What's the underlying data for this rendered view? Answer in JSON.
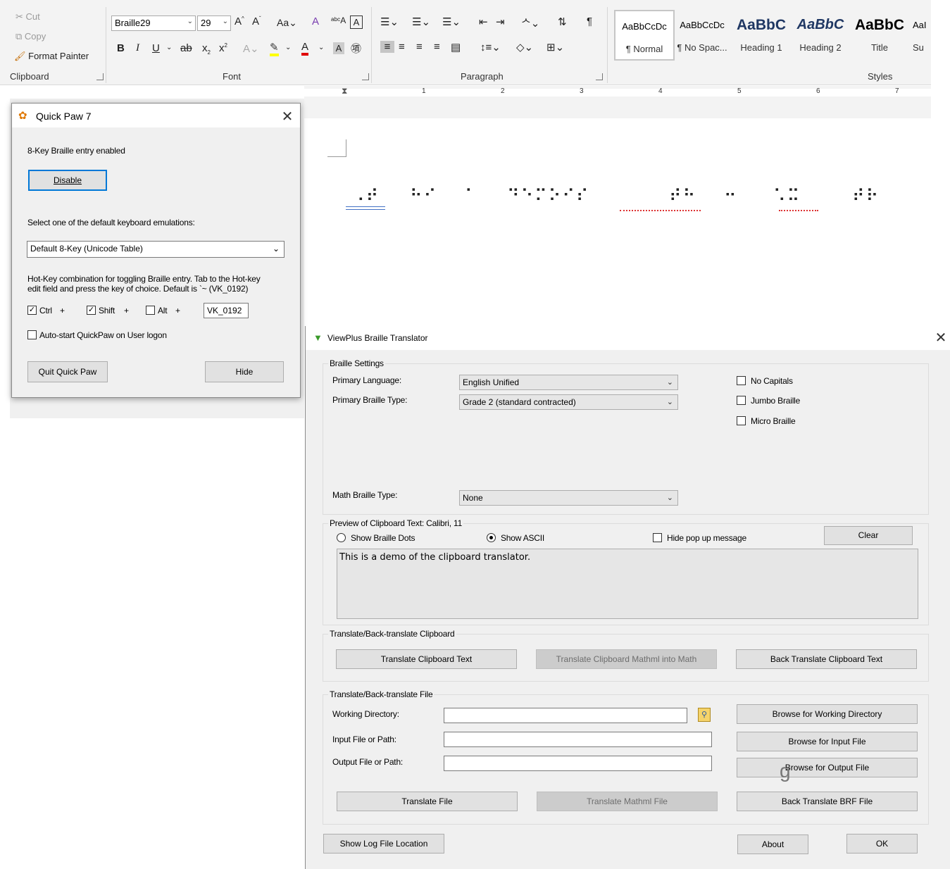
{
  "ribbon": {
    "clipboard": {
      "cut": "Cut",
      "copy": "Copy",
      "format_painter": "Format Painter",
      "group_label": "Clipboard"
    },
    "font": {
      "name": "Braille29",
      "size": "29",
      "group_label": "Font"
    },
    "paragraph": {
      "group_label": "Paragraph"
    },
    "styles": {
      "group_label": "Styles",
      "items": [
        {
          "preview": "AaBbCcDc",
          "name": "¶ Normal"
        },
        {
          "preview": "AaBbCcDc",
          "name": "¶ No Spac..."
        },
        {
          "preview": "AaBbC",
          "name": "Heading 1"
        },
        {
          "preview": "AaBbC",
          "name": "Heading 2"
        },
        {
          "preview": "AaBbC",
          "name": "Title"
        },
        {
          "preview": "AaI",
          "name": "Su"
        }
      ]
    }
  },
  "ruler": {
    "numbers": [
      "1",
      "2",
      "3",
      "4",
      "5",
      "6",
      "7"
    ]
  },
  "document": {
    "braille_words": [
      "⠠⠞",
      "⠓⠊",
      "⠁",
      "⠙⠑⠍⠕⠊⠎",
      "⠞⠓",
      "⠒",
      "⠡⠭",
      "⠞⠗"
    ]
  },
  "quickpaw": {
    "title": "Quick Paw 7",
    "status": "8-Key Braille entry enabled",
    "disable_label": "Disable",
    "select_label": "Select one of the default keyboard emulations:",
    "emulation_value": "Default 8-Key (Unicode Table)",
    "hotkey_text_1": "Hot-Key combination for toggling Braille entry.  Tab to the Hot-key",
    "hotkey_text_2": "edit field and press the key of choice.  Default is `~ (VK_0192)",
    "ctrl_label": "Ctrl",
    "shift_label": "Shift",
    "alt_label": "Alt",
    "plus": "+",
    "ctrl_checked": "✓",
    "shift_checked": "✓",
    "hotkey_value": "VK_0192",
    "autostart_label": "Auto-start QuickPaw on User logon",
    "quit_label": "Quit Quick Paw",
    "hide_label": "Hide",
    "close": "✕"
  },
  "translator": {
    "title": "ViewPlus Braille Translator",
    "close": "✕",
    "braille_settings": {
      "group_label": "Braille Settings",
      "primary_language_label": "Primary Language:",
      "primary_language_value": "English Unified",
      "primary_type_label": "Primary Braille Type:",
      "primary_type_value": "Grade 2 (standard contracted)",
      "math_type_label": "Math Braille Type:",
      "math_type_value": "None",
      "no_capitals": "No Capitals",
      "jumbo_braille": "Jumbo Braille",
      "micro_braille": "Micro Braille"
    },
    "preview": {
      "group_label": "Preview of Clipboard Text: Calibri, 11",
      "show_dots": "Show Braille Dots",
      "show_ascii": "Show ASCII",
      "hide_popup": "Hide pop up message",
      "clear": "Clear",
      "text": "This is a demo of the clipboard translator."
    },
    "clipboard_group": {
      "group_label": "Translate/Back-translate Clipboard",
      "translate_text": "Translate Clipboard Text",
      "translate_mathml": "Translate Clipboard Mathml into Math",
      "back_translate": "Back Translate Clipboard Text"
    },
    "file_group": {
      "group_label": "Translate/Back-translate File",
      "working_dir_label": "Working Directory:",
      "input_label": "Input File or Path:",
      "output_label": "Output File or Path:",
      "browse_working": "Browse for Working Directory",
      "browse_input": "Browse for Input File",
      "browse_output": "Browse for Output File",
      "translate_file": "Translate File",
      "translate_mathml_file": "Translate Mathml File",
      "back_translate_brf": "Back Translate BRF File",
      "stray_char": "g"
    },
    "footer": {
      "show_log": "Show Log File Location",
      "about": "About",
      "ok": "OK"
    }
  }
}
